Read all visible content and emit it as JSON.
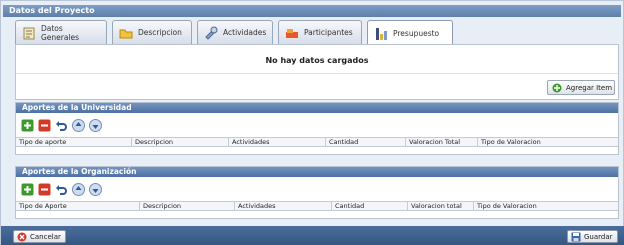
{
  "panel": {
    "title": "Datos del Proyecto"
  },
  "tabs": [
    {
      "label": "Datos Generales",
      "icon": "notepad-icon"
    },
    {
      "label": "Descripcion",
      "icon": "folder-icon"
    },
    {
      "label": "Actividades",
      "icon": "tools-icon"
    },
    {
      "label": "Participantes",
      "icon": "people-icon"
    },
    {
      "label": "Presupuesto",
      "icon": "budget-icon",
      "active": true
    }
  ],
  "content": {
    "message": "No hay datos cargados"
  },
  "add_button": {
    "label": "Agregar Item"
  },
  "section_universidad": {
    "title": "Aportes de la Universidad",
    "columns": [
      "Tipo de aporte",
      "Descripcion",
      "Actividades",
      "Cantidad",
      "Valoracion Total",
      "Tipo de Valoracion"
    ]
  },
  "section_organizacion": {
    "title": "Aportes de la Organización",
    "columns": [
      "Tipo de Aporte",
      "Descripcion",
      "Actividades",
      "Cantidad",
      "Valoracion total",
      "Tipo de Valoracion"
    ]
  },
  "footer": {
    "cancel_label": "Cancelar",
    "save_label": "Guardar"
  },
  "colors": {
    "header_blue": "#5d7fa9",
    "footer_blue": "#3b5d8a",
    "add_green": "#3c9a2c",
    "delete_red": "#d23a2a"
  }
}
